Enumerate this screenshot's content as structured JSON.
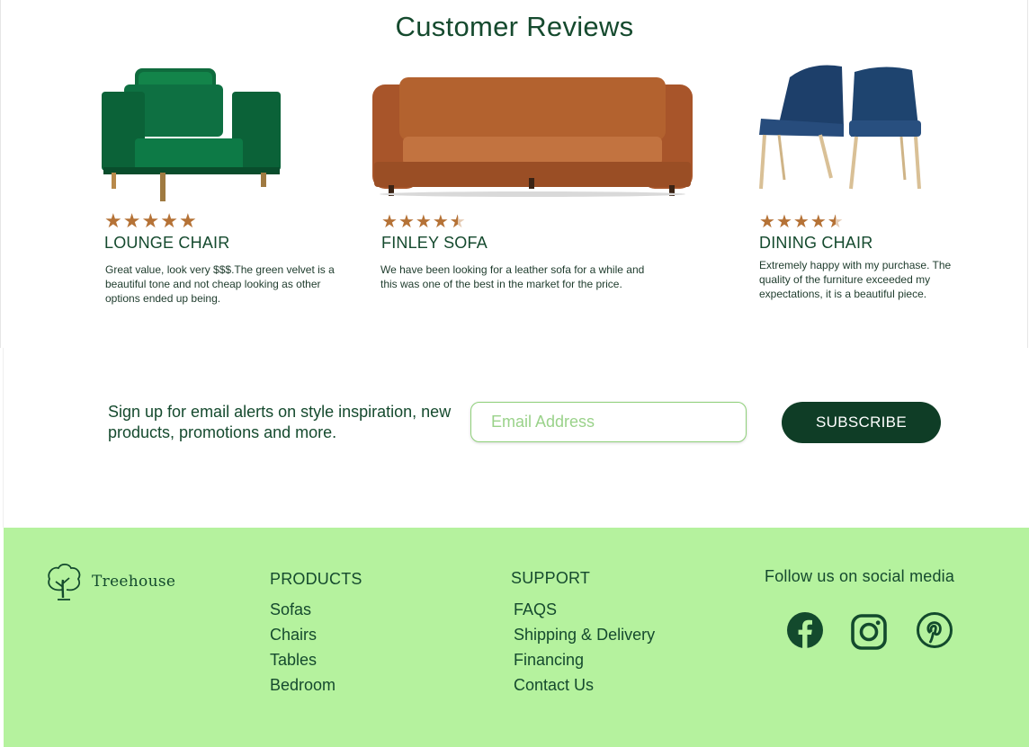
{
  "reviews": {
    "title": "Customer Reviews",
    "items": [
      {
        "product": "LOUNGE CHAIR",
        "rating": 5,
        "text_line1": "Great value, look very $$$.The green velvet is a",
        "text_line2": "beautiful tone and not cheap looking as other",
        "text_line3": "options ended up being."
      },
      {
        "product": "FINLEY SOFA",
        "rating": 4.5,
        "text_line1": "We have been looking for a  leather sofa for a while and",
        "text_line2": "this was one of the best in the market  for the price."
      },
      {
        "product": "DINING CHAIR",
        "rating": 4.5,
        "text_line1": "Extremely happy with my purchase. The",
        "text_line2": "quality of the furniture exceeded my",
        "text_line3": "expectations, it is a beautiful piece."
      }
    ]
  },
  "signup": {
    "text": "Sign up for email alerts on style inspiration, new products, promotions and more.",
    "email_placeholder": "Email Address",
    "button_label": "SUBSCRIBE"
  },
  "footer": {
    "brand": "Treehouse",
    "products": {
      "heading": "PRODUCTS",
      "links": [
        "Sofas",
        "Chairs",
        "Tables",
        "Bedroom"
      ]
    },
    "support": {
      "heading": "SUPPORT",
      "links": [
        "FAQS",
        "Shipping & Delivery",
        "Financing",
        "Contact Us"
      ]
    },
    "social": {
      "heading": "Follow us on social media",
      "icons": [
        "facebook-icon",
        "instagram-icon",
        "pinterest-icon"
      ]
    }
  },
  "colors": {
    "brand_dark": "#0f3d26",
    "footer_bg": "#b5f29e",
    "star": "#b57236",
    "input_border": "#8fd07a"
  }
}
